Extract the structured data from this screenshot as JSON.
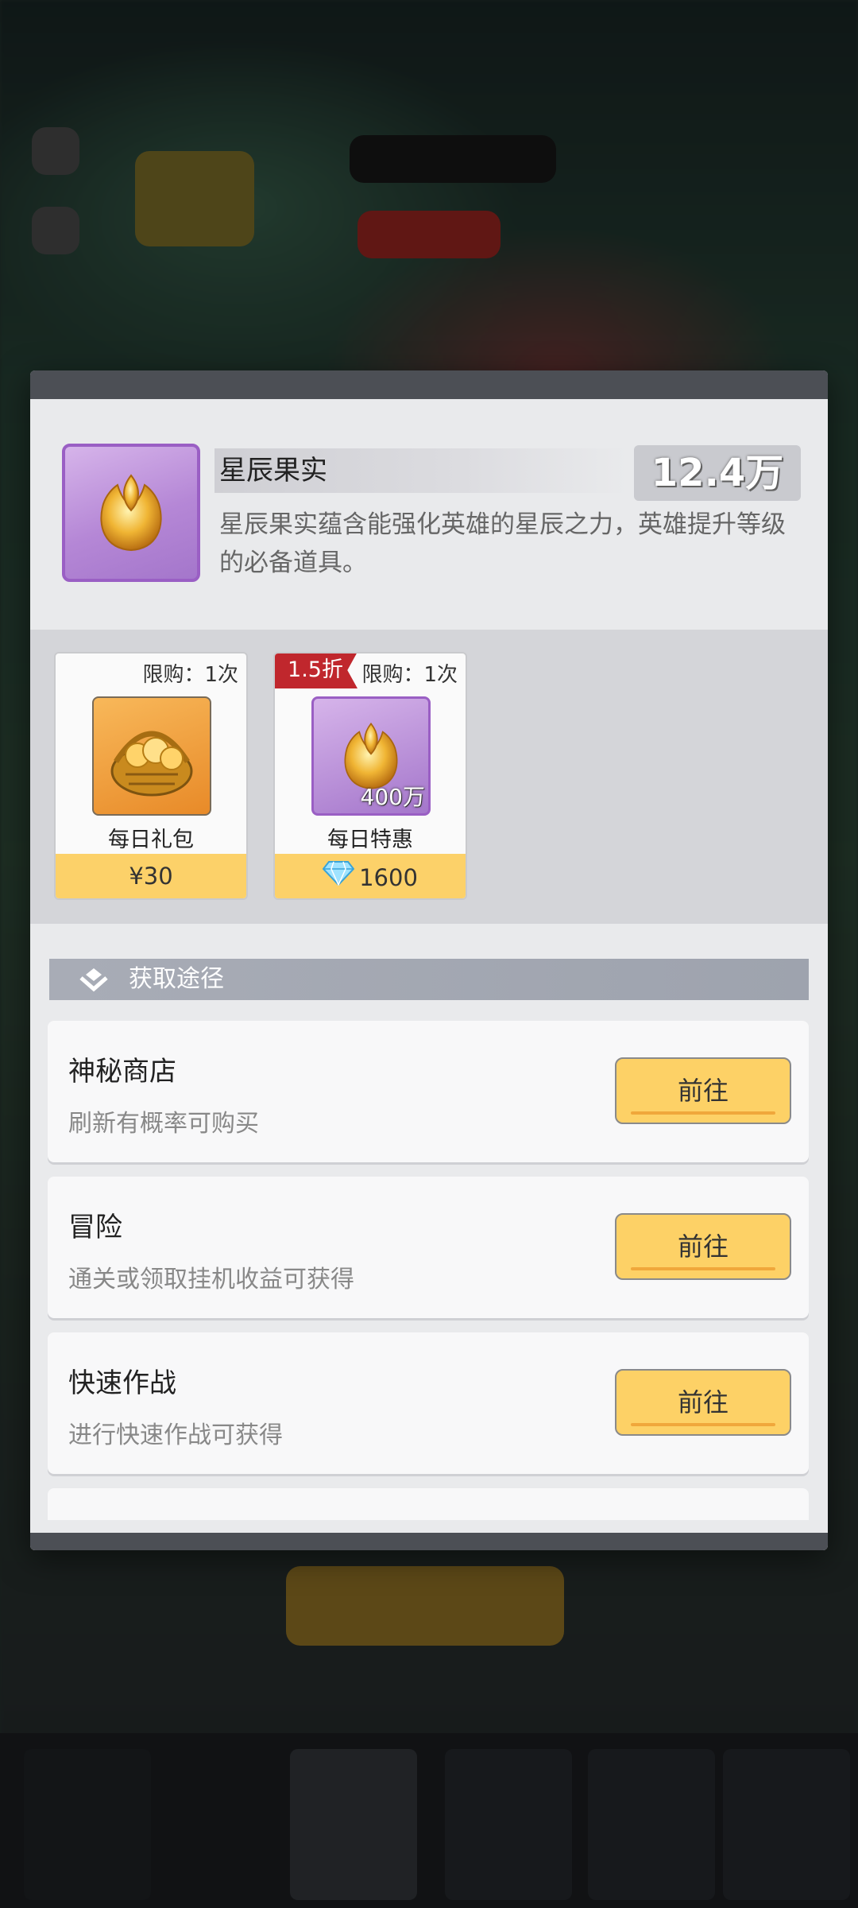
{
  "item": {
    "name": "星辰果实",
    "count": "12.4万",
    "description": "星辰果实蕴含能强化英雄的星辰之力，英雄提升等级的必备道具。",
    "icon": "golden-tulip-icon"
  },
  "shop": [
    {
      "limit": "限购：1次",
      "name": "每日礼包",
      "price": "¥30",
      "icon": "fruit-basket-icon"
    },
    {
      "discount": "1.5折",
      "limit": "限购：1次",
      "name": "每日特惠",
      "quantity": "400万",
      "price": "1600",
      "price_icon": "diamond-icon",
      "icon": "golden-tulip-icon"
    }
  ],
  "sources": {
    "header": "获取途径",
    "items": [
      {
        "title": "神秘商店",
        "desc": "刷新有概率可购买",
        "button": "前往"
      },
      {
        "title": "冒险",
        "desc": "通关或领取挂机收益可获得",
        "button": "前往"
      },
      {
        "title": "快速作战",
        "desc": "进行快速作战可获得",
        "button": "前往"
      }
    ]
  }
}
